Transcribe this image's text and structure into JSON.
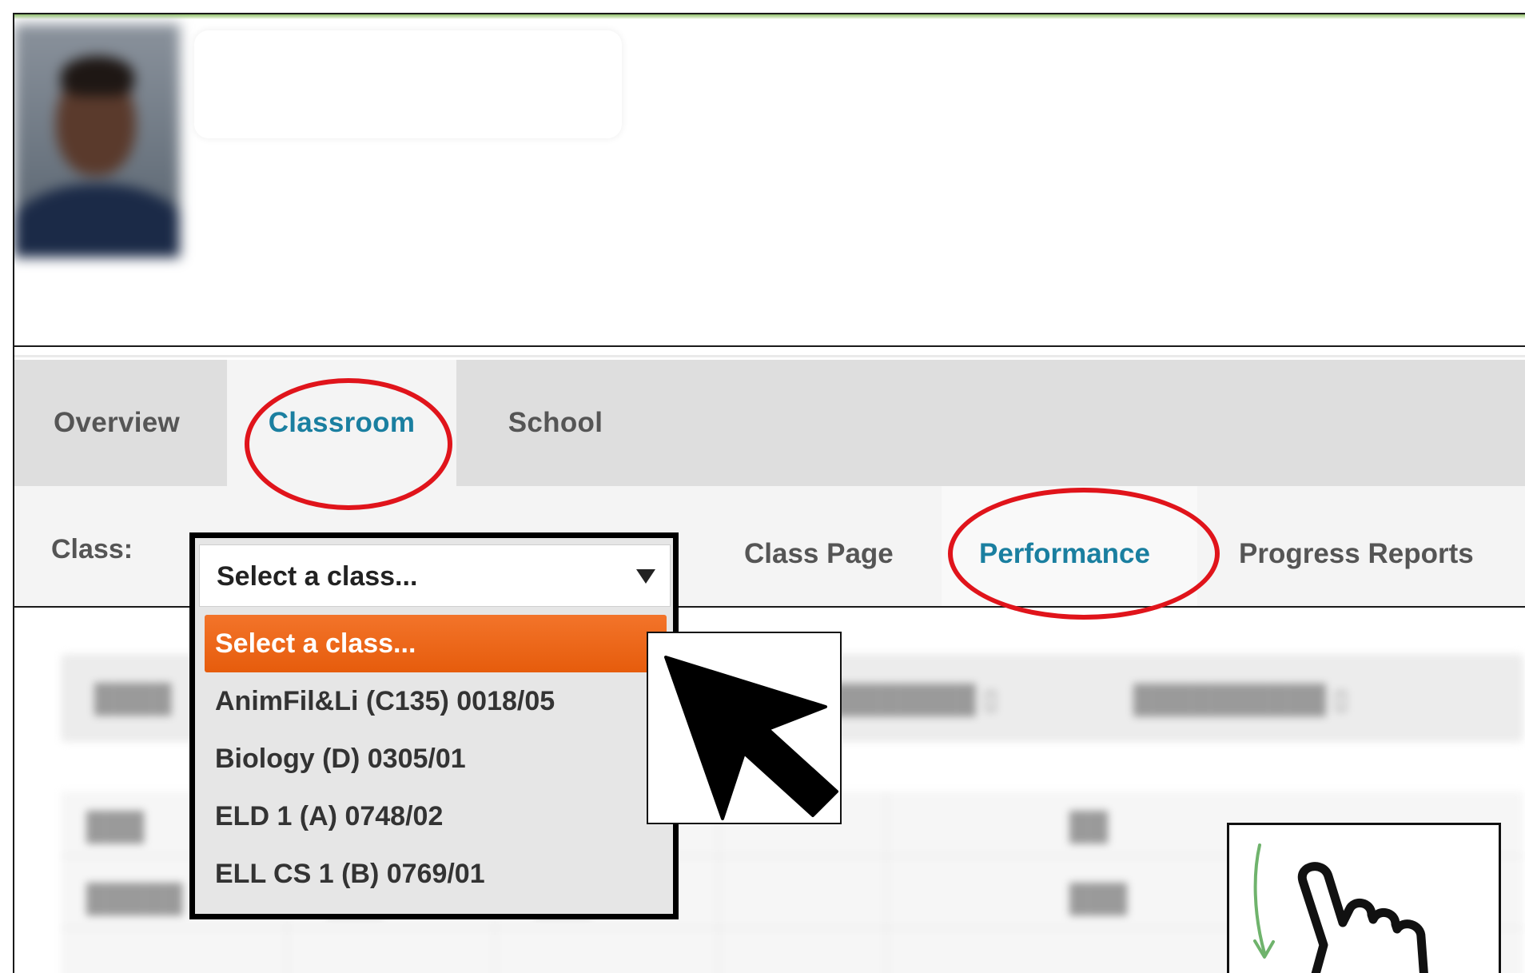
{
  "tabs": {
    "overview": "Overview",
    "classroom": "Classroom",
    "school": "School"
  },
  "class_bar": {
    "label": "Class:",
    "select_value": "Select a class...",
    "options": [
      "Select a class...",
      "AnimFil&Li (C135) 0018/05",
      "Biology (D) 0305/01",
      "ELD 1 (A) 0748/02",
      "ELL CS 1 (B) 0769/01"
    ]
  },
  "sub_tabs": {
    "class_page": "Class Page",
    "performance": "Performance",
    "progress_reports": "Progress Reports"
  },
  "colors": {
    "active_tab": "#1a7fa0",
    "selected_option": "#f0671b",
    "annotation": "#e0141b"
  }
}
